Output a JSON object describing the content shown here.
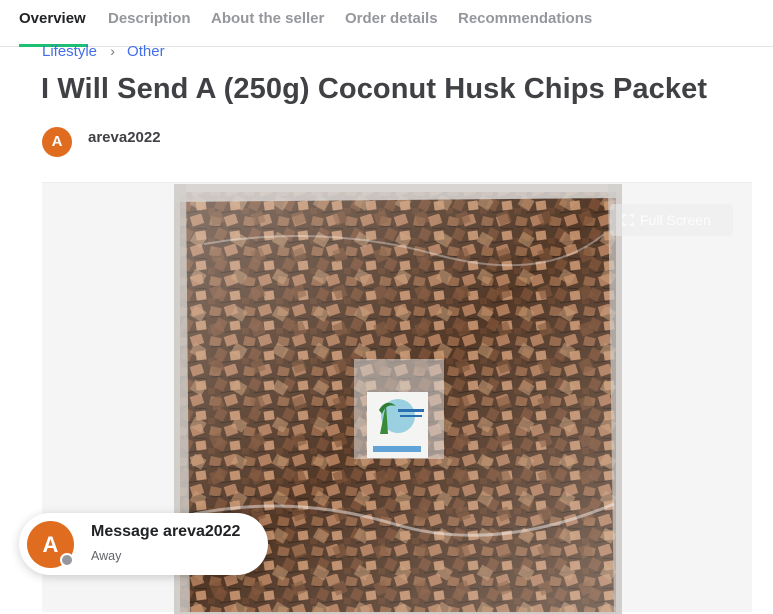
{
  "tabs": [
    {
      "label": "Overview",
      "active": true
    },
    {
      "label": "Description",
      "active": false
    },
    {
      "label": "About the seller",
      "active": false
    },
    {
      "label": "Order details",
      "active": false
    },
    {
      "label": "Recommendations",
      "active": false
    }
  ],
  "breadcrumb": {
    "items": [
      "Lifestyle",
      "Other"
    ],
    "separator": "›"
  },
  "gig": {
    "title": "I Will Send A (250g) Coconut Husk Chips Packet"
  },
  "seller": {
    "initial": "A",
    "username": "areva2022",
    "avatar_color": "#e06d1f"
  },
  "gallery": {
    "fullscreen_label": "Full Screen",
    "image_description_icon": "product-photo"
  },
  "message": {
    "initial": "A",
    "title": "Message areva2022",
    "status": "Away",
    "status_color": "#95979d"
  },
  "colors": {
    "active_tab_underline": "#1dbf73",
    "link": "#446ee7",
    "text": "#404145"
  }
}
